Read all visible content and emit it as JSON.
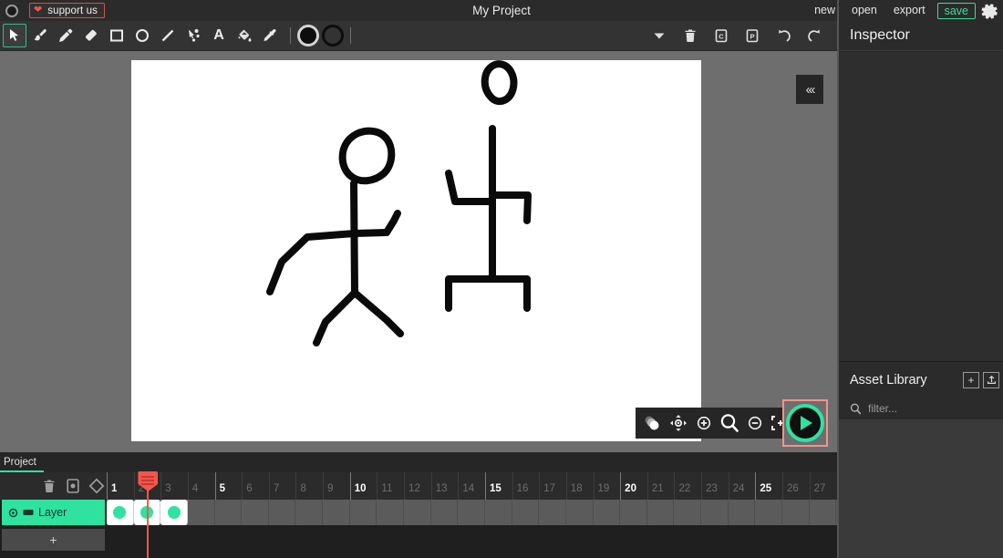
{
  "titlebar": {
    "logo_icon": "app-logo-icon",
    "support_label": "support us",
    "support_icon": "heart-icon",
    "project_title": "My Project",
    "menu": [
      {
        "label": "new",
        "name": "new"
      },
      {
        "label": "open",
        "name": "open"
      },
      {
        "label": "export",
        "name": "export"
      }
    ],
    "save_label": "save",
    "settings_icon": "gear-icon",
    "accent_green": "#3ddc97",
    "accent_red": "#c9564f"
  },
  "toolbar": {
    "tools": [
      {
        "name": "select-tool",
        "icon": "cursor-icon",
        "active": true
      },
      {
        "name": "brush-tool",
        "icon": "brush-icon",
        "active": false
      },
      {
        "name": "pencil-tool",
        "icon": "pencil-icon",
        "active": false
      },
      {
        "name": "eraser-tool",
        "icon": "eraser-icon",
        "active": false
      },
      {
        "name": "rectangle-tool",
        "icon": "rectangle-icon",
        "active": false
      },
      {
        "name": "ellipse-tool",
        "icon": "ellipse-icon",
        "active": false
      },
      {
        "name": "line-tool",
        "icon": "line-icon",
        "active": false
      },
      {
        "name": "path-tool",
        "icon": "path-node-icon",
        "active": false
      },
      {
        "name": "text-tool",
        "icon": "text-a-icon",
        "active": false
      },
      {
        "name": "fill-tool",
        "icon": "paint-bucket-icon",
        "active": false
      },
      {
        "name": "eyedropper-tool",
        "icon": "eyedropper-icon",
        "active": false
      }
    ],
    "fill_color": "#0d0d0d",
    "stroke_color": "#0d0d0d",
    "right_tools": [
      {
        "name": "more-options",
        "icon": "chevron-down-icon"
      },
      {
        "name": "delete",
        "icon": "trash-icon"
      },
      {
        "name": "copy",
        "icon": "copy-c-icon"
      },
      {
        "name": "paste",
        "icon": "paste-p-icon"
      },
      {
        "name": "undo",
        "icon": "undo-icon"
      },
      {
        "name": "redo",
        "icon": "redo-icon"
      }
    ]
  },
  "canvas": {
    "collapse_icon": "chevron-left-triple-icon",
    "view_tools": [
      {
        "name": "onion-skin",
        "icon": "onion-skin-icon"
      },
      {
        "name": "pan",
        "icon": "pan-move-icon"
      },
      {
        "name": "zoom-in",
        "icon": "zoom-in-icon"
      },
      {
        "name": "zoom",
        "icon": "magnifier-icon"
      },
      {
        "name": "zoom-out",
        "icon": "zoom-out-icon"
      },
      {
        "name": "fit-to-screen",
        "icon": "fit-screen-icon"
      }
    ],
    "play_icon": "play-icon",
    "play_accent": "#2fe2a0",
    "highlight_border": "#f2948c"
  },
  "timeline": {
    "tab_label": "Project",
    "head_tools": [
      {
        "name": "delete-frame",
        "icon": "trash-icon"
      },
      {
        "name": "add-frame",
        "icon": "frame-box-icon"
      },
      {
        "name": "add-keyframe",
        "icon": "diamond-icon"
      }
    ],
    "frame_numbers": [
      1,
      2,
      3,
      4,
      5,
      6,
      7,
      8,
      9,
      10,
      11,
      12,
      13,
      14,
      15,
      16,
      17,
      18,
      19,
      20,
      21,
      22,
      23,
      24,
      25,
      26,
      27
    ],
    "major_frames": [
      1,
      5,
      10,
      15,
      20,
      25
    ],
    "playhead_frame": 2,
    "layer": {
      "label": "Layer",
      "visibility_icon": "eye-icon",
      "onion-icon": "onion-toggle-icon",
      "color": "#2fe2a0"
    },
    "add_layer_label": "+",
    "filled_frames": [
      1,
      2,
      3
    ]
  },
  "inspector": {
    "title": "Inspector"
  },
  "asset_library": {
    "title": "Asset Library",
    "add_label": "+",
    "add_icon": "plus-icon",
    "import_icon": "upload-icon",
    "search_icon": "search-icon",
    "filter_placeholder": "filter..."
  }
}
